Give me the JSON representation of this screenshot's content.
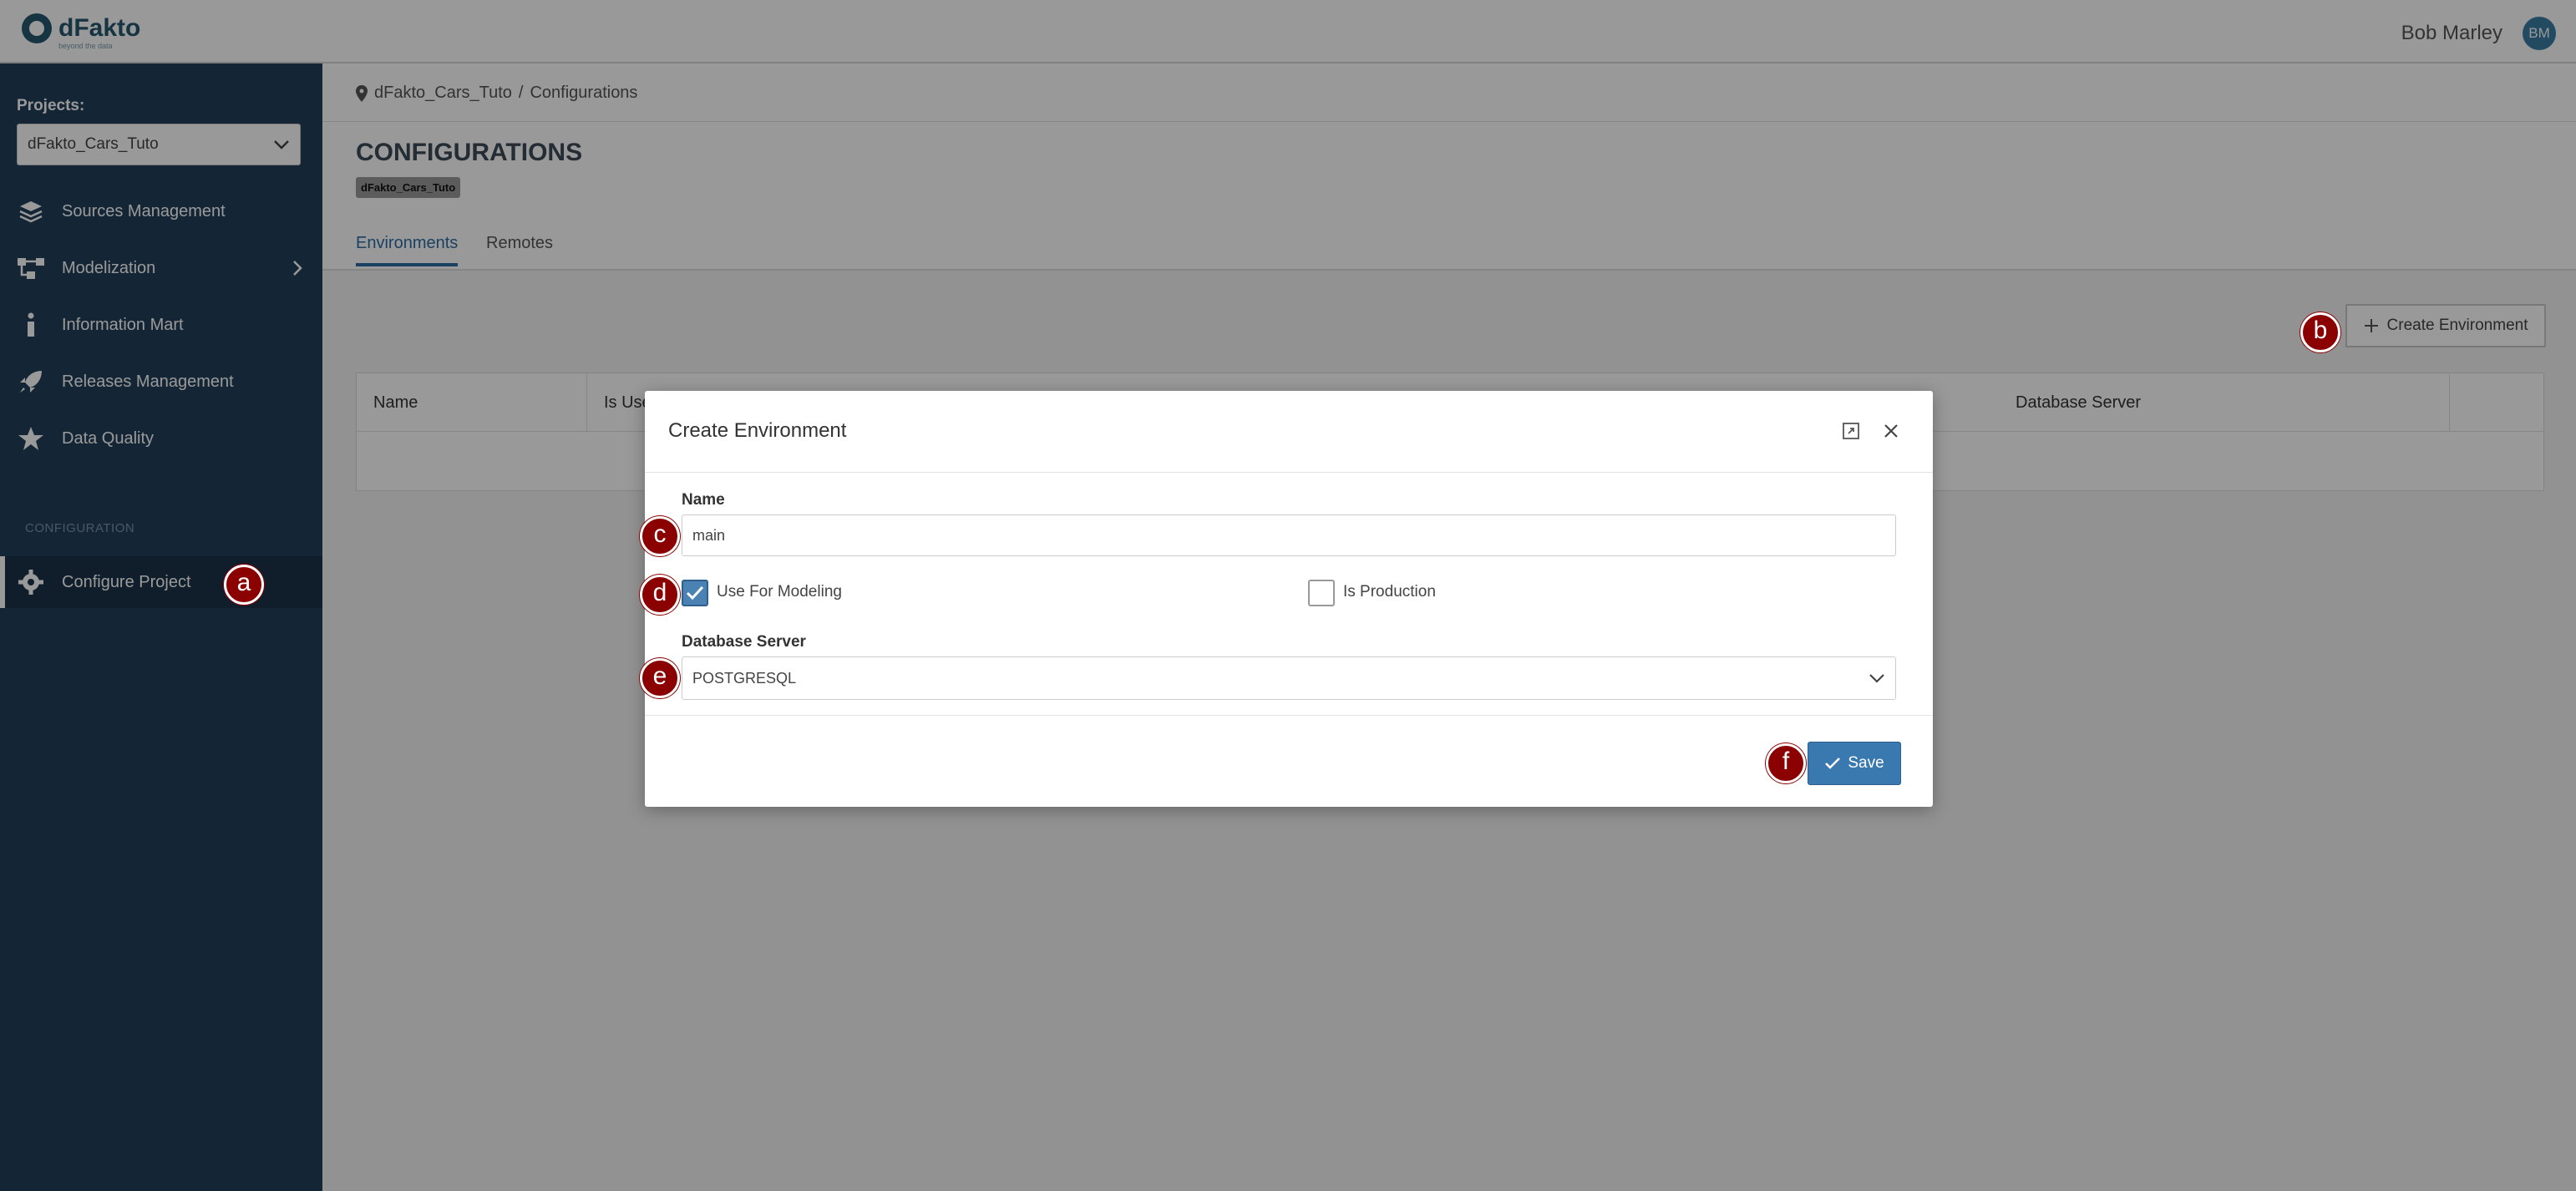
{
  "app": {
    "logo_text": "dFakto",
    "logo_tagline": "beyond the data",
    "user_name": "Bob Marley",
    "user_initials": "BM"
  },
  "sidebar": {
    "projects_label": "Projects:",
    "project_selected": "dFakto_Cars_Tuto",
    "items": [
      {
        "label": "Sources Management",
        "icon": "layers-icon"
      },
      {
        "label": "Modelization",
        "icon": "network-icon"
      },
      {
        "label": "Information Mart",
        "icon": "info-icon"
      },
      {
        "label": "Releases Management",
        "icon": "rocket-icon"
      },
      {
        "label": "Data Quality",
        "icon": "star-icon"
      }
    ],
    "section_label": "CONFIGURATION",
    "configure_project": "Configure Project"
  },
  "breadcrumb": {
    "project": "dFakto_Cars_Tuto",
    "separator": "/",
    "page": "Configurations"
  },
  "page": {
    "title": "CONFIGURATIONS",
    "badge": "dFakto_Cars_Tuto",
    "tabs": [
      "Environments",
      "Remotes"
    ],
    "create_button": "Create Environment"
  },
  "table": {
    "headers": [
      "Name",
      "Is Use",
      "Database Server"
    ]
  },
  "modal": {
    "title": "Create Environment",
    "name_label": "Name",
    "name_value": "main",
    "use_for_modeling_label": "Use For Modeling",
    "use_for_modeling_checked": true,
    "is_production_label": "Is Production",
    "is_production_checked": false,
    "db_server_label": "Database Server",
    "db_server_value": "POSTGRESQL",
    "save_label": "Save"
  },
  "annotations": [
    "a",
    "b",
    "c",
    "d",
    "e",
    "f"
  ],
  "colors": {
    "sidebar_bg": "#22405a",
    "accent": "#3a78b0",
    "marker": "#8b0000"
  }
}
